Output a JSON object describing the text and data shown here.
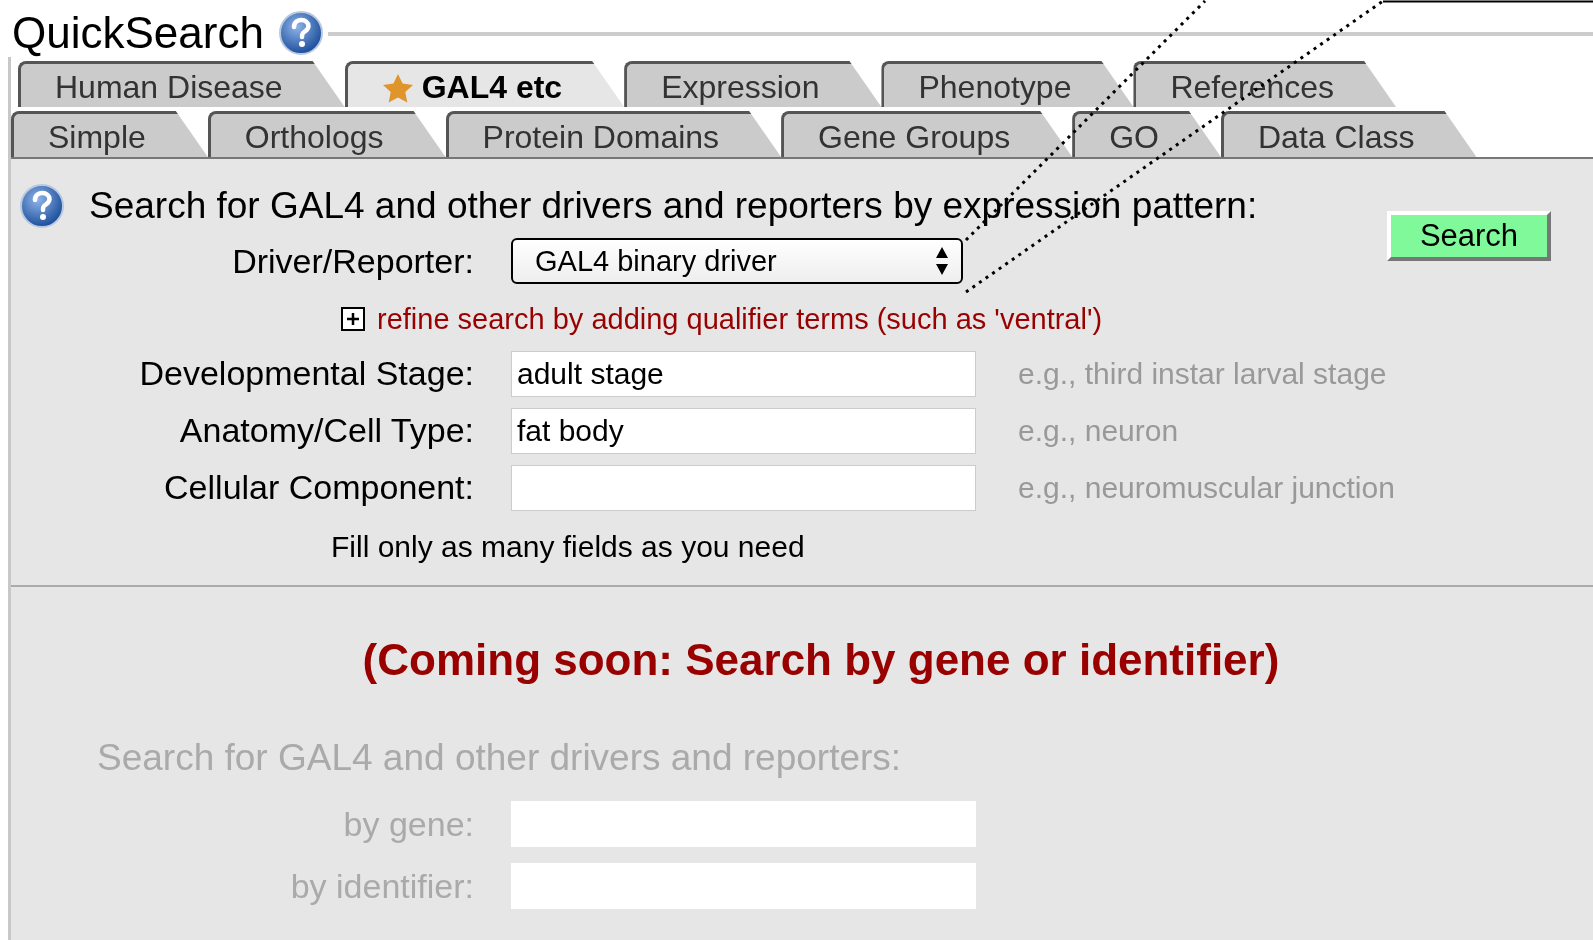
{
  "title": "QuickSearch",
  "tab_rows": [
    [
      {
        "label": "Human Disease",
        "selected": false,
        "starred": false
      },
      {
        "label": "GAL4 etc",
        "selected": true,
        "starred": true
      },
      {
        "label": "Expression",
        "selected": false,
        "starred": false
      },
      {
        "label": "Phenotype",
        "selected": false,
        "starred": false
      },
      {
        "label": "References",
        "selected": false,
        "starred": false
      }
    ],
    [
      {
        "label": "Simple",
        "selected": false,
        "starred": false
      },
      {
        "label": "Orthologs",
        "selected": false,
        "starred": false
      },
      {
        "label": "Protein Domains",
        "selected": false,
        "starred": false
      },
      {
        "label": "Gene Groups",
        "selected": false,
        "starred": false
      },
      {
        "label": "GO",
        "selected": false,
        "starred": false
      },
      {
        "label": "Data Class",
        "selected": false,
        "starred": false
      }
    ]
  ],
  "expression_search": {
    "prompt": "Search for GAL4 and other drivers and reporters by expression pattern:",
    "driver_reporter": {
      "label": "Driver/Reporter:",
      "value": "GAL4 binary driver"
    },
    "refine": {
      "label": "refine search by adding qualifier terms (such as 'ventral')",
      "expanded": false
    },
    "fields": [
      {
        "label": "Developmental Stage:",
        "value": "adult stage",
        "hint": "e.g., third instar larval stage"
      },
      {
        "label": "Anatomy/Cell Type:",
        "value": "fat body",
        "hint": "e.g., neuron"
      },
      {
        "label": "Cellular Component:",
        "hint": "e.g., neuromuscular junction"
      }
    ],
    "note": "Fill only as many fields as you need",
    "button": "Search"
  },
  "coming_soon": {
    "heading": "(Coming soon: Search by gene or identifier)",
    "prompt": "Search for GAL4 and other drivers and reporters:",
    "disabled": true,
    "fields": [
      {
        "label": "by gene:"
      },
      {
        "label": "by identifier:"
      }
    ]
  }
}
